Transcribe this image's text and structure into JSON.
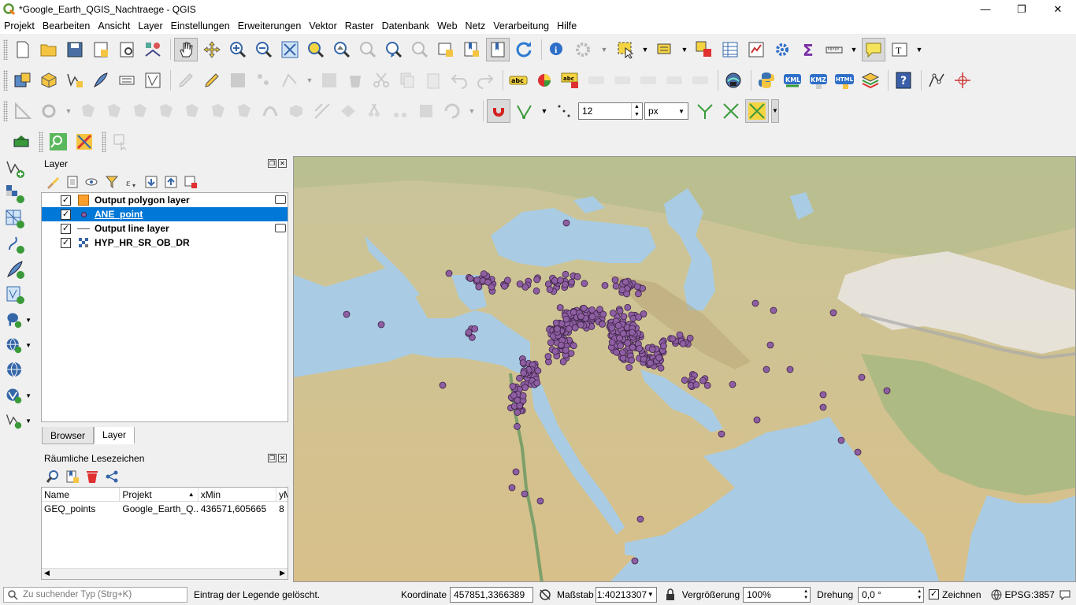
{
  "window": {
    "title": "*Google_Earth_QGIS_Nachtraege - QGIS",
    "minimize": "—",
    "maximize": "❐",
    "close": "✕"
  },
  "menu": [
    "Projekt",
    "Bearbeiten",
    "Ansicht",
    "Layer",
    "Einstellungen",
    "Erweiterungen",
    "Vektor",
    "Raster",
    "Datenbank",
    "Web",
    "Netz",
    "Verarbeitung",
    "Hilfe"
  ],
  "toolbar": {
    "snap_tolerance": "12",
    "snap_unit": "px",
    "labels": {
      "abc": "abc",
      "kml": "KML",
      "kmz": "KMZ",
      "html": "HTML"
    }
  },
  "layers_panel": {
    "title": "Layer",
    "layers": [
      {
        "name": "Output polygon layer",
        "checked": true,
        "selected": false,
        "symbol": "polygon-orange",
        "editable": true
      },
      {
        "name": "ANE_point",
        "checked": true,
        "selected": true,
        "symbol": "point-purple",
        "editable": false
      },
      {
        "name": "Output line layer",
        "checked": true,
        "selected": false,
        "symbol": "line",
        "editable": true
      },
      {
        "name": "HYP_HR_SR_OB_DR",
        "checked": true,
        "selected": false,
        "symbol": "raster",
        "editable": false
      }
    ],
    "tabs": [
      "Browser",
      "Layer"
    ],
    "active_tab": "Layer"
  },
  "bookmarks_panel": {
    "title": "Räumliche Lesezeichen",
    "columns": [
      "Name",
      "Projekt",
      "xMin",
      "yM"
    ],
    "rows": [
      {
        "name": "GEQ_points",
        "project": "Google_Earth_Q...",
        "xmin": "436571,605665",
        "ymin": "8"
      }
    ]
  },
  "statusbar": {
    "search_placeholder": "Zu suchender Typ (Strg+K)",
    "message": "Eintrag der Legende gelöscht.",
    "coord_label": "Koordinate",
    "coord_value": "457851,3366389",
    "scale_label": "Maßstab",
    "scale_value": "1:40213307",
    "magnifier_label": "Vergrößerung",
    "magnifier_value": "100%",
    "rotation_label": "Drehung",
    "rotation_value": "0,0 °",
    "render_label": "Zeichnen",
    "crs": "EPSG:3857"
  },
  "colors": {
    "accent": "#0078d7",
    "point_fill": "#8e5ea2",
    "point_stroke": "#3d2347",
    "polygon": "#ff9f2b",
    "sea": "#a9cce4",
    "land": "#d9c79a"
  }
}
